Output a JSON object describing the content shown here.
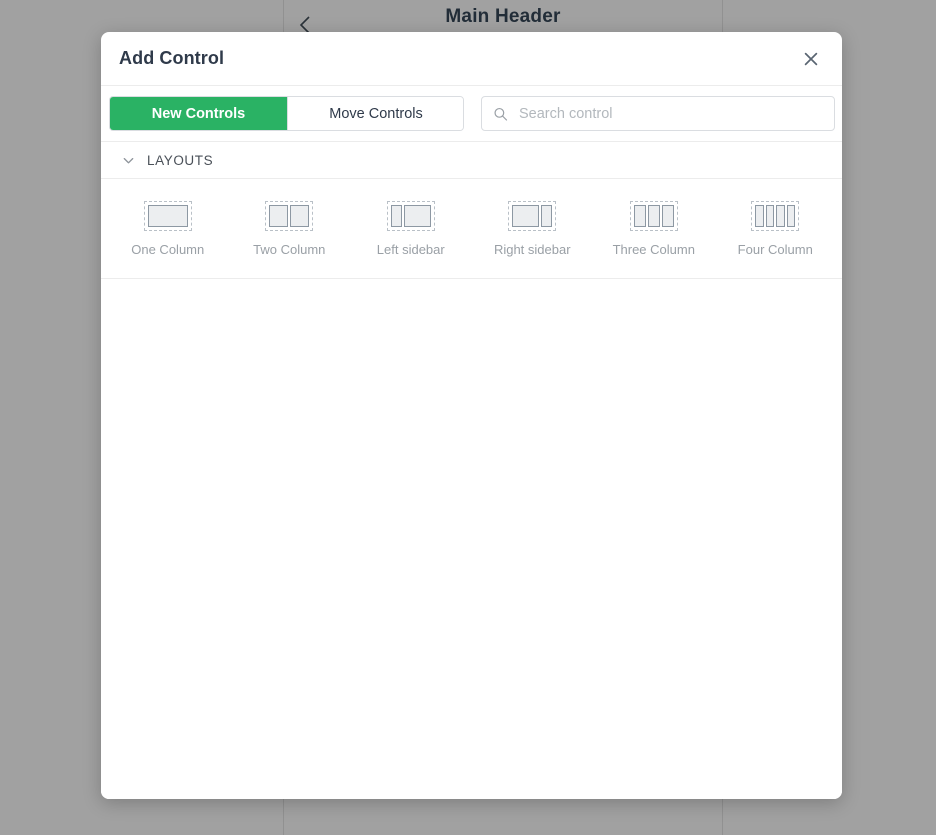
{
  "background": {
    "header_title": "Main Header",
    "back_icon": "chevron-left-icon",
    "accent_color": "#2f8f5b"
  },
  "dialog": {
    "title": "Add Control",
    "close_icon": "close-icon",
    "close_label": "Close"
  },
  "toolbar": {
    "tabs": [
      {
        "label": "New Controls",
        "active": true
      },
      {
        "label": "Move Controls",
        "active": false
      }
    ],
    "search": {
      "icon": "search-icon",
      "placeholder": "Search control",
      "value": ""
    }
  },
  "sections": [
    {
      "title": "LAYOUTS",
      "expanded": true,
      "chevron_icon": "chevron-down-icon",
      "items": [
        {
          "label": "One Column",
          "icon": "layout-one-column-icon",
          "columns": [
            1
          ]
        },
        {
          "label": "Two Column",
          "icon": "layout-two-column-icon",
          "columns": [
            1,
            1
          ]
        },
        {
          "label": "Left sidebar",
          "icon": "layout-left-sidebar-icon",
          "columns": [
            1,
            2.6
          ]
        },
        {
          "label": "Right sidebar",
          "icon": "layout-right-sidebar-icon",
          "columns": [
            2.6,
            1
          ]
        },
        {
          "label": "Three Column",
          "icon": "layout-three-column-icon",
          "columns": [
            1,
            1,
            1
          ]
        },
        {
          "label": "Four Column",
          "icon": "layout-four-column-icon",
          "columns": [
            1,
            1,
            1,
            1
          ]
        }
      ]
    }
  ],
  "colors": {
    "accent_green": "#2ab264",
    "title_text": "#2f3a4a",
    "muted_text": "#9aa0a6",
    "overlay": "rgba(20,20,20,0.40)"
  }
}
